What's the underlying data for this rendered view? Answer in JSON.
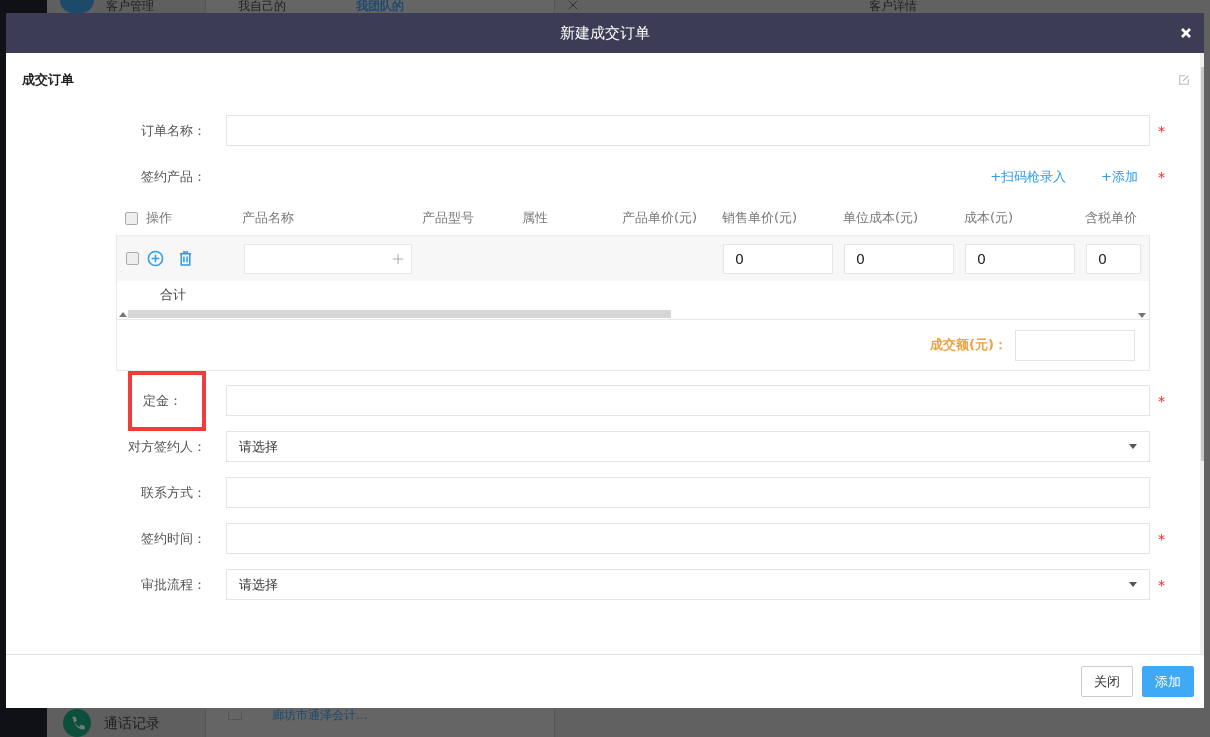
{
  "background": {
    "nav_items": [
      {
        "label": "客户管理",
        "kind": "customers"
      },
      {
        "label": "通话记录",
        "kind": "calls"
      }
    ],
    "tabs": [
      {
        "label": "我自己的",
        "selected": false
      },
      {
        "label": "我团队的",
        "selected": true
      }
    ],
    "detail_title": "客户详情",
    "list_item": "廊坊市通泽会计...",
    "list_item_checked": false
  },
  "dialog": {
    "title": "新建成交订单",
    "section_title": "成交订单",
    "fields": [
      {
        "kind": "text",
        "label": "订单名称：",
        "required_mark": "*",
        "highlighted": false
      },
      {
        "kind": "products",
        "label": "签约产品：",
        "required_mark": "*",
        "highlighted": false,
        "actions": [
          "+扫码枪录入",
          "+添加"
        ]
      },
      {
        "kind": "text",
        "label": "定金：",
        "required_mark": "*",
        "highlighted": true
      },
      {
        "kind": "select",
        "label": "对方签约人：",
        "placeholder": "请选择",
        "highlighted": false
      },
      {
        "kind": "text",
        "label": "联系方式：",
        "highlighted": false
      },
      {
        "kind": "text",
        "label": "签约时间：",
        "required_mark": "*",
        "highlighted": false
      },
      {
        "kind": "select",
        "label": "审批流程：",
        "placeholder": "请选择",
        "required_mark": "*",
        "highlighted": false
      }
    ],
    "product_table": {
      "header_checked": false,
      "columns": [
        "操作",
        "产品名称",
        "产品型号",
        "属性",
        "产品单价(元)",
        "销售单价(元)",
        "单位成本(元)",
        "成本(元)",
        "含税单价"
      ],
      "rows": [
        {
          "checked": false,
          "amounts": [
            "0",
            "0",
            "0",
            "0"
          ]
        }
      ],
      "total_label": "合计",
      "deal_amount_label": "成交额(元)："
    },
    "buttons": [
      {
        "label": "关闭",
        "kind": "secondary"
      },
      {
        "label": "添加",
        "kind": "primary"
      }
    ]
  }
}
